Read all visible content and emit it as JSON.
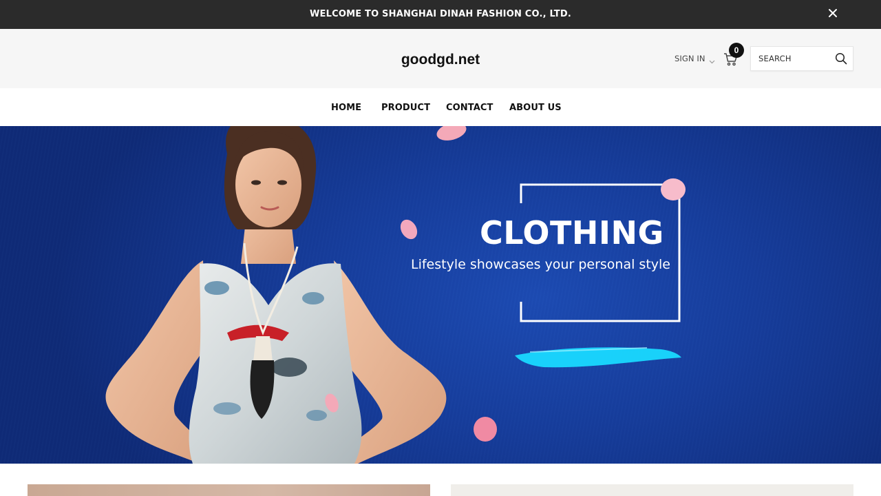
{
  "announcement": {
    "text": "WELCOME TO SHANGHAI DINAH FASHION CO., LTD.",
    "close_icon": "close-icon"
  },
  "header": {
    "logo": "goodgd.net",
    "sign_in_label": "SIGN IN",
    "cart_count": "0",
    "search_placeholder": "SEARCH",
    "icons": [
      "chevron-down-icon",
      "cart-icon",
      "search-icon"
    ]
  },
  "nav": {
    "items": [
      {
        "label": "HOME"
      },
      {
        "label": "PRODUCT"
      },
      {
        "label": "CONTACT"
      },
      {
        "label": "ABOUT US"
      }
    ]
  },
  "hero": {
    "title": "CLOTHING",
    "subtitle": "Lifestyle showcases your personal style"
  },
  "colors": {
    "announcement_bg": "#2b2b2b",
    "header_bg": "#f6f6f6",
    "hero_bg": "#163d9c",
    "brush_accent": "#19d9ff",
    "petal": "#f4a9b8"
  }
}
